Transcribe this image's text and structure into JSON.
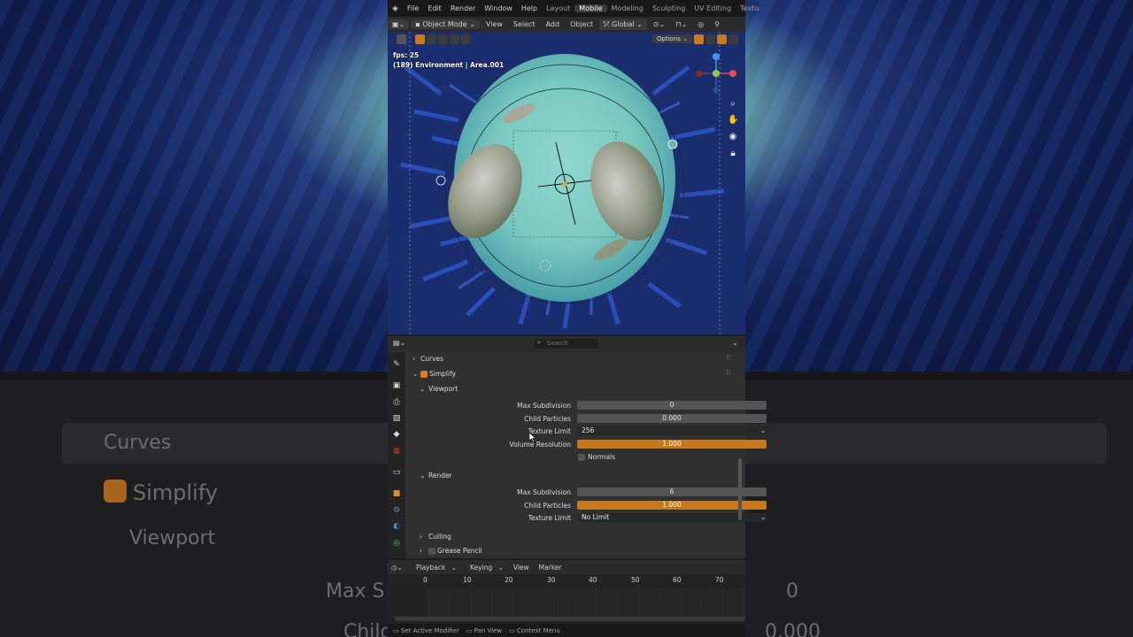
{
  "topbar": {
    "menus": [
      "File",
      "Edit",
      "Render",
      "Window",
      "Help"
    ],
    "workspaces": [
      "Layout",
      "Mobile",
      "Modeling",
      "Sculpting",
      "UV Editing",
      "Textu"
    ],
    "active_workspace": "Mobile"
  },
  "viewport_header": {
    "mode": "Object Mode",
    "menus": [
      "View",
      "Select",
      "Add",
      "Object"
    ],
    "orientation": "Global",
    "options": "Options"
  },
  "viewport": {
    "fps": "fps: 25",
    "info": "(189) Environment | Area.001"
  },
  "properties": {
    "search_placeholder": "Search",
    "curves": "Curves",
    "simplify": "Simplify",
    "viewport_section": "Viewport",
    "viewport_fields": [
      {
        "label": "Max Subdivision",
        "value": "0"
      },
      {
        "label": "Child Particles",
        "value": "0.000"
      },
      {
        "label": "Texture Limit",
        "value": "256"
      },
      {
        "label": "Volume Resolution",
        "value": "1.000"
      }
    ],
    "normals": "Normals",
    "render_section": "Render",
    "render_fields": [
      {
        "label": "Max Subdivision",
        "value": "6"
      },
      {
        "label": "Child Particles",
        "value": "1.000"
      },
      {
        "label": "Texture Limit",
        "value": "No Limit"
      }
    ],
    "culling": "Culling",
    "grease_pencil": "Grease Pencil"
  },
  "timeline": {
    "menus": [
      "Playback",
      "Keying",
      "View",
      "Marker"
    ],
    "ticks": [
      "0",
      "10",
      "20",
      "30",
      "40",
      "50",
      "60",
      "70"
    ]
  },
  "statusbar": {
    "items": [
      "Set Active Modifier",
      "Pan View",
      "Context Menu"
    ]
  },
  "background": {
    "curves": "Curves",
    "simplify": "Simplify",
    "viewport": "Viewport",
    "max": "Max S",
    "child": "Child",
    "zero": "0",
    "zeros": "0.000"
  },
  "colors": {
    "accent": "#c6781b",
    "active_tab": "#3a3a3a"
  }
}
